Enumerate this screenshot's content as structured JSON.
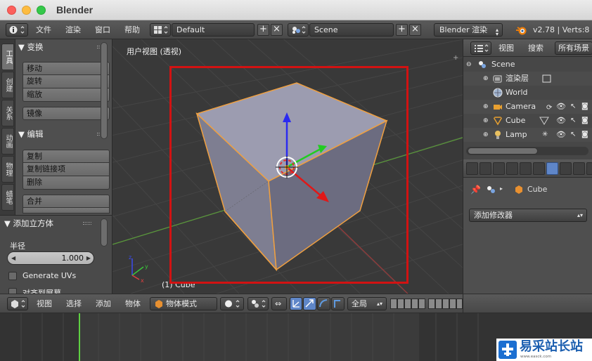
{
  "window": {
    "title": "Blender"
  },
  "info_header": {
    "menus": [
      "文件",
      "渲染",
      "窗口",
      "帮助"
    ],
    "screen_layout": "Default",
    "scene": "Scene",
    "render_engine": "Blender 渲染",
    "version_stats": "v2.78 | Verts:8"
  },
  "toolshelf": {
    "tabs": [
      "工具",
      "创建",
      "关系",
      "动画",
      "物理",
      "蜡笔"
    ],
    "transform_panel": {
      "title": "变换",
      "buttons": [
        "移动",
        "旋转",
        "缩放",
        "镜像"
      ]
    },
    "edit_panel": {
      "title": "编辑",
      "buttons": [
        "复制",
        "复制链接项",
        "删除",
        "合并"
      ]
    }
  },
  "operator_panel": {
    "title": "添加立方体",
    "radius_label": "半径",
    "radius_value": "1.000",
    "generate_uvs": "Generate UVs",
    "align_view": "对齐到屏幕"
  },
  "viewport": {
    "label": "用户视图 (透视)",
    "object_info": "(1) Cube"
  },
  "outliner": {
    "menus": [
      "视图",
      "搜索"
    ],
    "filter": "所有场景",
    "rows": [
      "Scene",
      "渲染层",
      "World",
      "Camera",
      "Cube",
      "Lamp"
    ]
  },
  "properties": {
    "context_object": "Cube",
    "add_modifier": "添加修改器"
  },
  "view3d_header": {
    "menus": [
      "视图",
      "选择",
      "添加",
      "物体"
    ],
    "mode": "物体模式",
    "orientation": "全局"
  },
  "watermark": {
    "text": "易采站长站",
    "sub": "www.easck.com"
  }
}
